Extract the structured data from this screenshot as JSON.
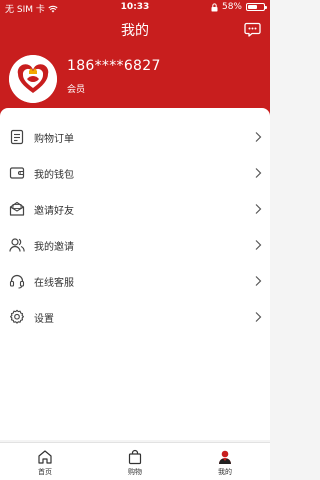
{
  "status_bar": {
    "carrier": "无 SIM 卡",
    "time": "10:33",
    "battery_text": "58%",
    "battery_level": 0.58
  },
  "header": {
    "title": "我的",
    "message_icon": "message-dots-icon"
  },
  "profile": {
    "phone": "186****6827",
    "level": "会员",
    "avatar_icon": "heart-logo-avatar"
  },
  "menu": {
    "items": [
      {
        "label": "购物订单",
        "icon": "order-list-icon"
      },
      {
        "label": "我的钱包",
        "icon": "wallet-icon"
      },
      {
        "label": "邀请好友",
        "icon": "mail-invite-icon"
      },
      {
        "label": "我的邀请",
        "icon": "users-icon"
      },
      {
        "label": "在线客服",
        "icon": "headset-icon"
      },
      {
        "label": "设置",
        "icon": "gear-icon"
      }
    ]
  },
  "tabbar": {
    "items": [
      {
        "label": "首页",
        "icon": "home-icon",
        "active": false
      },
      {
        "label": "购物",
        "icon": "shopping-bag-icon",
        "active": false
      },
      {
        "label": "我的",
        "icon": "profile-icon",
        "active": true
      }
    ]
  },
  "colors": {
    "brand_red": "#c81e1e",
    "text_dark": "#333333",
    "icon_gray": "#444444"
  }
}
